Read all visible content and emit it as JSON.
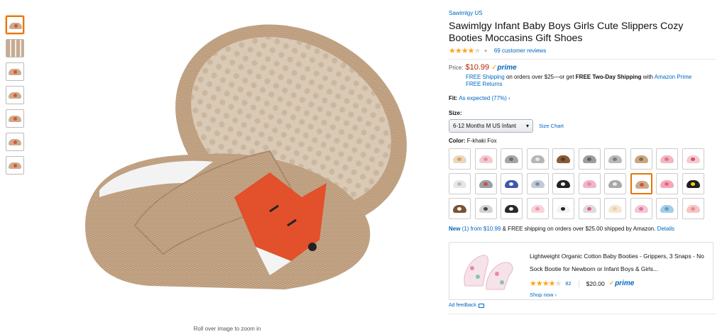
{
  "product": {
    "brand": "Sawimlgy US",
    "title": "Sawimlgy Infant Baby Boys Girls Cute Slippers Cozy Booties Moccasins Gift Shoes",
    "rating": 4,
    "rating_stars": "★★★★",
    "rating_star_empty": "★",
    "review_count_label": "69 customer reviews",
    "image_hint": "Roll over image to zoom in",
    "thumbnails": [
      "shoe-thumb-1",
      "shoe-thumb-2",
      "shoe-thumb-3",
      "shoe-thumb-4",
      "shoe-thumb-5",
      "shoe-thumb-6",
      "shoe-thumb-7"
    ]
  },
  "price": {
    "label": "Price:",
    "amount": "$10.99",
    "prime_label": "prime",
    "shipping_free": "FREE Shipping",
    "shipping_mid": "on orders over $25—or get",
    "shipping_two_day": "FREE Two-Day Shipping",
    "shipping_with": "with",
    "amazon_prime": "Amazon Prime",
    "returns": "FREE Returns"
  },
  "fit": {
    "label": "Fit:",
    "value": "As expected (77%)",
    "chevron": "›"
  },
  "size": {
    "label": "Size:",
    "selected": "6-12 Months M US Infant",
    "chart_link": "Size Chart"
  },
  "color": {
    "label": "Color:",
    "selected": "F-khaki Fox",
    "accent": "#e77600",
    "swatches": [
      {
        "body": "#ead7c0",
        "accent": "#d9a25e"
      },
      {
        "body": "#f3c9cf",
        "accent": "#e88e9d"
      },
      {
        "body": "#a5a5a5",
        "accent": "#6d6d6d"
      },
      {
        "body": "#b6b6b6",
        "accent": "#e7e7e7"
      },
      {
        "body": "#8b5a36",
        "accent": "#5d3a1e"
      },
      {
        "body": "#9c9c9c",
        "accent": "#5f5f5f"
      },
      {
        "body": "#b9b9b9",
        "accent": "#7c7c7c"
      },
      {
        "body": "#c9a77f",
        "accent": "#8d6b45"
      },
      {
        "body": "#f2b6c2",
        "accent": "#e07487"
      },
      {
        "body": "#f4c9d2",
        "accent": "#d95068"
      },
      {
        "body": "#e6e6e6",
        "accent": "#bbbbbb"
      },
      {
        "body": "#9aa0a6",
        "accent": "#d64a3b"
      },
      {
        "body": "#3b5aa7",
        "accent": "#f0f0f0"
      },
      {
        "body": "#c2c9d8",
        "accent": "#7d8aa8"
      },
      {
        "body": "#222222",
        "accent": "#f4f4f4"
      },
      {
        "body": "#f2b4cc",
        "accent": "#e28bb0"
      },
      {
        "body": "#a8a8a8",
        "accent": "#e9e9e9"
      },
      {
        "body": "#c9ab8d",
        "accent": "#e2502c"
      },
      {
        "body": "#f6a6b8",
        "accent": "#e66483"
      },
      {
        "body": "#1f1f1f",
        "accent": "#ffd400"
      },
      {
        "body": "#7a5235",
        "accent": "#f5f5f5"
      },
      {
        "body": "#d2d2d2",
        "accent": "#444444"
      },
      {
        "body": "#2a2a2a",
        "accent": "#f0f0f0"
      },
      {
        "body": "#f7d3db",
        "accent": "#e99aaa"
      },
      {
        "body": "#f2f2f2",
        "accent": "#222222"
      },
      {
        "body": "#dcdcdc",
        "accent": "#e55a84"
      },
      {
        "body": "#f4e6d3",
        "accent": "#e6cfae"
      },
      {
        "body": "#f3c6d2",
        "accent": "#e2728f"
      },
      {
        "body": "#a6cde6",
        "accent": "#5aa0cf"
      },
      {
        "body": "#f7c3c3",
        "accent": "#e88d8d"
      }
    ],
    "selected_index": 17
  },
  "offers": {
    "new_label": "New",
    "new_count": "(1) from $10.99",
    "rest": "& FREE shipping on orders over $25.00 shipped by Amazon.",
    "details": "Details"
  },
  "ad": {
    "title": "Lightweight Organic Cotton Baby Booties - Grippers, 3 Snaps - No Sock Bootie for Newborn or Infant Boys & Girls...",
    "rating": 4.5,
    "stars": "★★★★",
    "half_star": "★",
    "review_count": "82",
    "price": "$20.00",
    "prime_label": "prime",
    "shop_now": "Shop now ›",
    "feedback": "Ad feedback"
  },
  "icons": [
    "chevron-down-icon",
    "prime-check-icon",
    "ad-feedback-icon"
  ]
}
